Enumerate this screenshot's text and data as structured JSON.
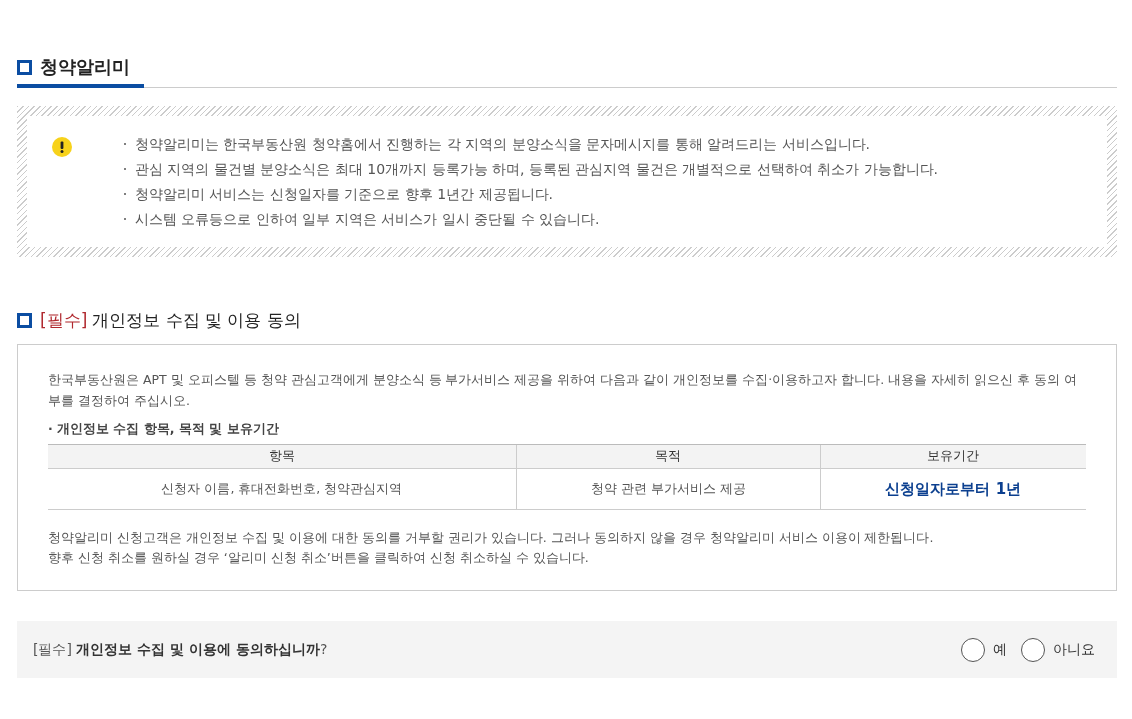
{
  "title": "청약알리미",
  "notice": [
    "청약알리미는 한국부동산원 청약홈에서 진행하는 각 지역의 분양소식을 문자메시지를 통해 알려드리는 서비스입니다.",
    "관심 지역의 물건별 분양소식은 최대 10개까지 등록가능 하며, 등록된 관심지역 물건은 개별적으로 선택하여 취소가 가능합니다.",
    "청약알리미 서비스는 신청일자를 기준으로 향후 1년간 제공됩니다.",
    "시스템 오류등으로 인하여 일부 지역은 서비스가 일시 중단될 수 있습니다."
  ],
  "consent": {
    "tag": "[필수]",
    "title": "개인정보 수집 및 이용 동의",
    "intro": "한국부동산원은 APT 및 오피스텔 등 청약 관심고객에게 분양소식 등 부가서비스 제공을 위하여 다음과 같이 개인정보를 수집·이용하고자 합니다. 내용을 자세히 읽으신 후 동의 여부를 결정하여 주십시오.",
    "subheading": "· 개인정보 수집 항목, 목적 및 보유기간",
    "table": {
      "columns": [
        "항목",
        "목적",
        "보유기간"
      ],
      "rows": [
        [
          "신청자 이름, 휴대전화번호, 청약관심지역",
          "청약 관련 부가서비스 제공",
          "신청일자로부터 1년"
        ]
      ]
    },
    "notes": [
      "청약알리미 신청고객은 개인정보 수집 및 이용에 대한 동의를 거부할 권리가 있습니다. 그러나 동의하지 않을 경우 청약알리미 서비스 이용이 제한됩니다.",
      "향후 신청 취소를 원하실 경우 ‘알리미 신청 취소’버튼을 클릭하여 신청 취소하실 수 있습니다."
    ]
  },
  "question": {
    "text": "[필수] **개인정보 수집 및 이용에 동의하십니까**?",
    "options": [
      {
        "label": "예",
        "selected": false
      },
      {
        "label": "아니요",
        "selected": false
      }
    ]
  }
}
